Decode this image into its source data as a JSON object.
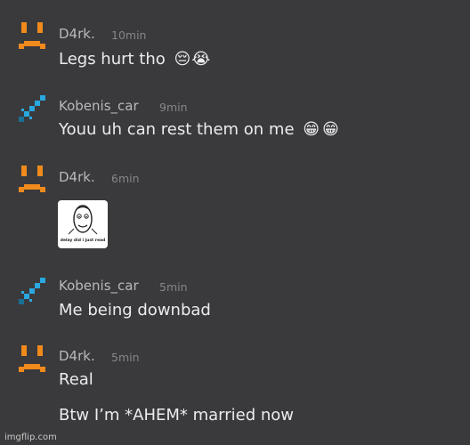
{
  "messages": [
    {
      "user": "D4rk.",
      "time": "10min",
      "avatar": "sad-face-icon",
      "text": "Legs hurt tho",
      "emojis": [
        "😔",
        "😭"
      ]
    },
    {
      "user": "Kobenis_car",
      "time": "9min",
      "avatar": "diamond-sword-icon",
      "text": "Youu uh can rest them on me",
      "emojis": [
        "😁",
        "😁"
      ]
    },
    {
      "user": "D4rk.",
      "time": "6min",
      "avatar": "sad-face-icon",
      "sticker_caption": "delay did i just read"
    },
    {
      "user": "Kobenis_car",
      "time": "5min",
      "avatar": "diamond-sword-icon",
      "text": "Me being downbad"
    },
    {
      "user": "D4rk.",
      "time": "5min",
      "avatar": "sad-face-icon",
      "text": "Real",
      "text2": "Btw I’m *AHEM* married now"
    }
  ],
  "watermark": "imgflip.com",
  "colors": {
    "background": "#3a3a3c",
    "sad_face": "#f08a1c",
    "sword": "#29a8e0",
    "sword_dark": "#1b6f95"
  }
}
